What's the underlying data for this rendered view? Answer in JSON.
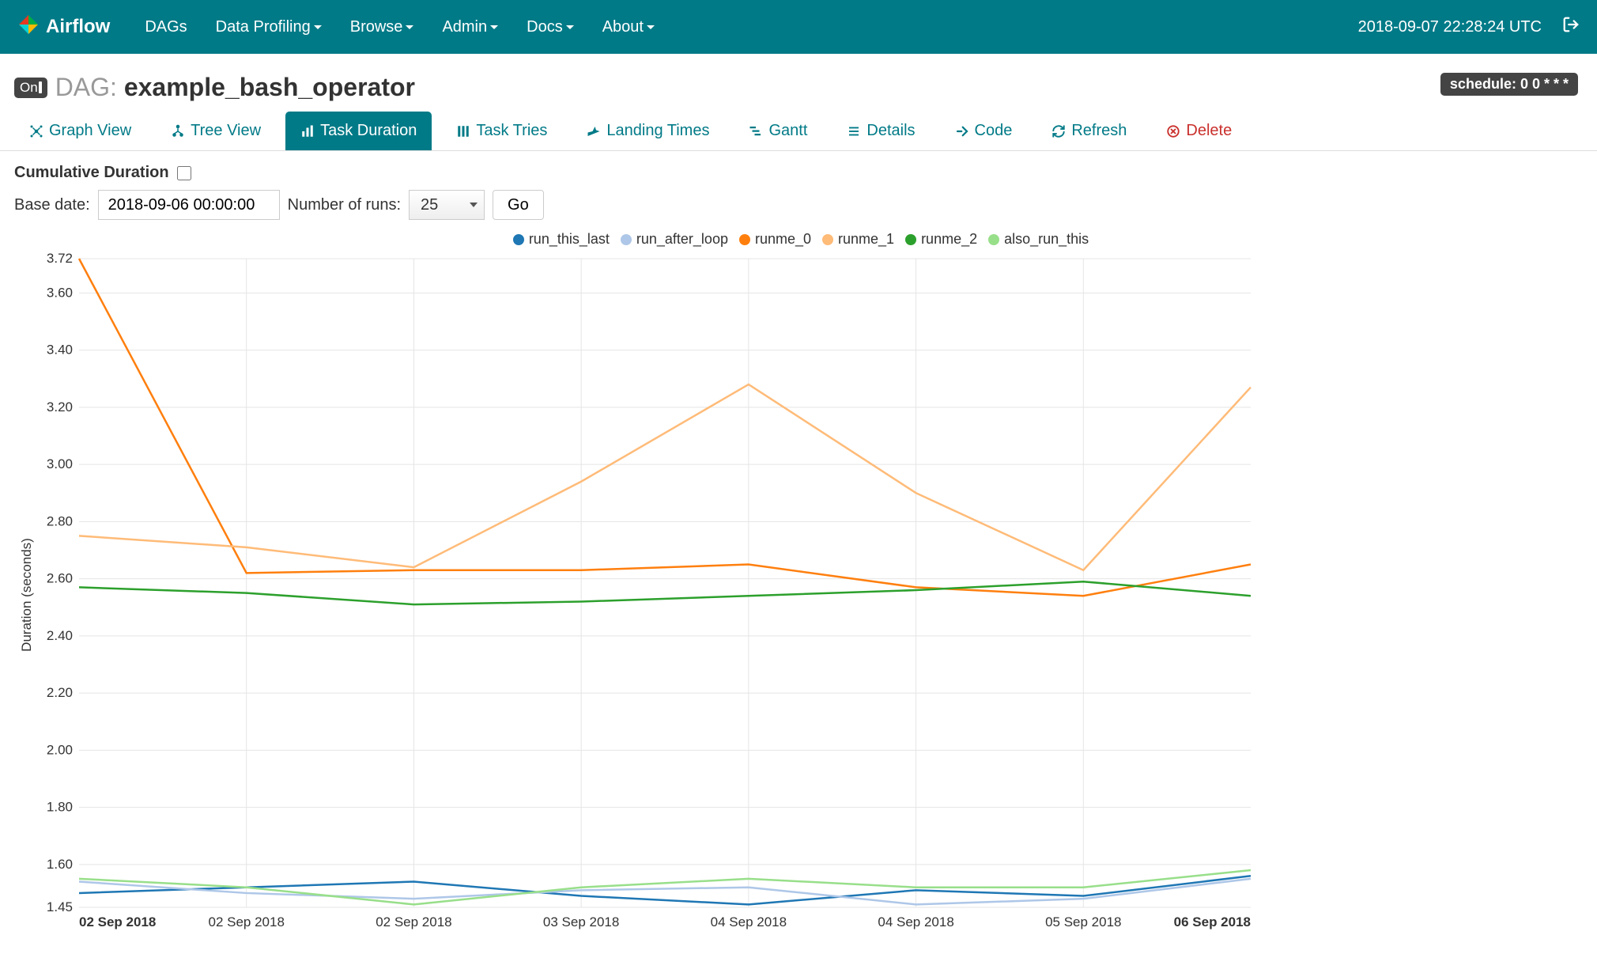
{
  "navbar": {
    "brand": "Airflow",
    "items": [
      "DAGs",
      "Data Profiling",
      "Browse",
      "Admin",
      "Docs",
      "About"
    ],
    "dropdown": [
      false,
      true,
      true,
      true,
      true,
      true
    ],
    "clock": "2018-09-07 22:28:24 UTC"
  },
  "header": {
    "toggle_label": "On",
    "dag_prefix": "DAG: ",
    "dag_name": "example_bash_operator",
    "schedule_label": "schedule: 0 0 * * *"
  },
  "tabs": {
    "items": [
      "Graph View",
      "Tree View",
      "Task Duration",
      "Task Tries",
      "Landing Times",
      "Gantt",
      "Details",
      "Code",
      "Refresh",
      "Delete"
    ],
    "active_index": 2
  },
  "controls": {
    "cumulative_label": "Cumulative Duration",
    "cumulative_checked": false,
    "base_date_label": "Base date:",
    "base_date_value": "2018-09-06 00:00:00",
    "num_runs_label": "Number of runs:",
    "num_runs_value": "25",
    "go_label": "Go"
  },
  "chart_data": {
    "type": "line",
    "ylabel": "Duration (seconds)",
    "ylim": [
      1.45,
      3.72
    ],
    "yticks": [
      1.45,
      1.6,
      1.8,
      2.0,
      2.2,
      2.4,
      2.6,
      2.8,
      3.0,
      3.2,
      3.4,
      3.6,
      3.72
    ],
    "x_labels": [
      "02 Sep 2018",
      "02 Sep 2018",
      "02 Sep 2018",
      "03 Sep 2018",
      "04 Sep 2018",
      "04 Sep 2018",
      "05 Sep 2018",
      "06 Sep 2018"
    ],
    "x_grid_indices": [
      1,
      2,
      3,
      4,
      5,
      6
    ],
    "x_bold_indices": [
      0,
      7
    ],
    "series": [
      {
        "name": "run_this_last",
        "color": "#1f77b4",
        "values": [
          1.5,
          1.52,
          1.54,
          1.49,
          1.46,
          1.51,
          1.49,
          1.56
        ]
      },
      {
        "name": "run_after_loop",
        "color": "#aec7e8",
        "values": [
          1.54,
          1.5,
          1.48,
          1.51,
          1.52,
          1.46,
          1.48,
          1.55
        ]
      },
      {
        "name": "runme_0",
        "color": "#ff7f0e",
        "values": [
          3.72,
          2.62,
          2.63,
          2.63,
          2.65,
          2.57,
          2.54,
          2.65
        ]
      },
      {
        "name": "runme_1",
        "color": "#ffbb78",
        "values": [
          2.75,
          2.71,
          2.64,
          2.94,
          3.28,
          2.9,
          2.63,
          3.27
        ]
      },
      {
        "name": "runme_2",
        "color": "#2ca02c",
        "values": [
          2.57,
          2.55,
          2.51,
          2.52,
          2.54,
          2.56,
          2.59,
          2.54
        ]
      },
      {
        "name": "also_run_this",
        "color": "#98df8a",
        "values": [
          1.55,
          1.52,
          1.46,
          1.52,
          1.55,
          1.52,
          1.52,
          1.58
        ]
      }
    ]
  }
}
